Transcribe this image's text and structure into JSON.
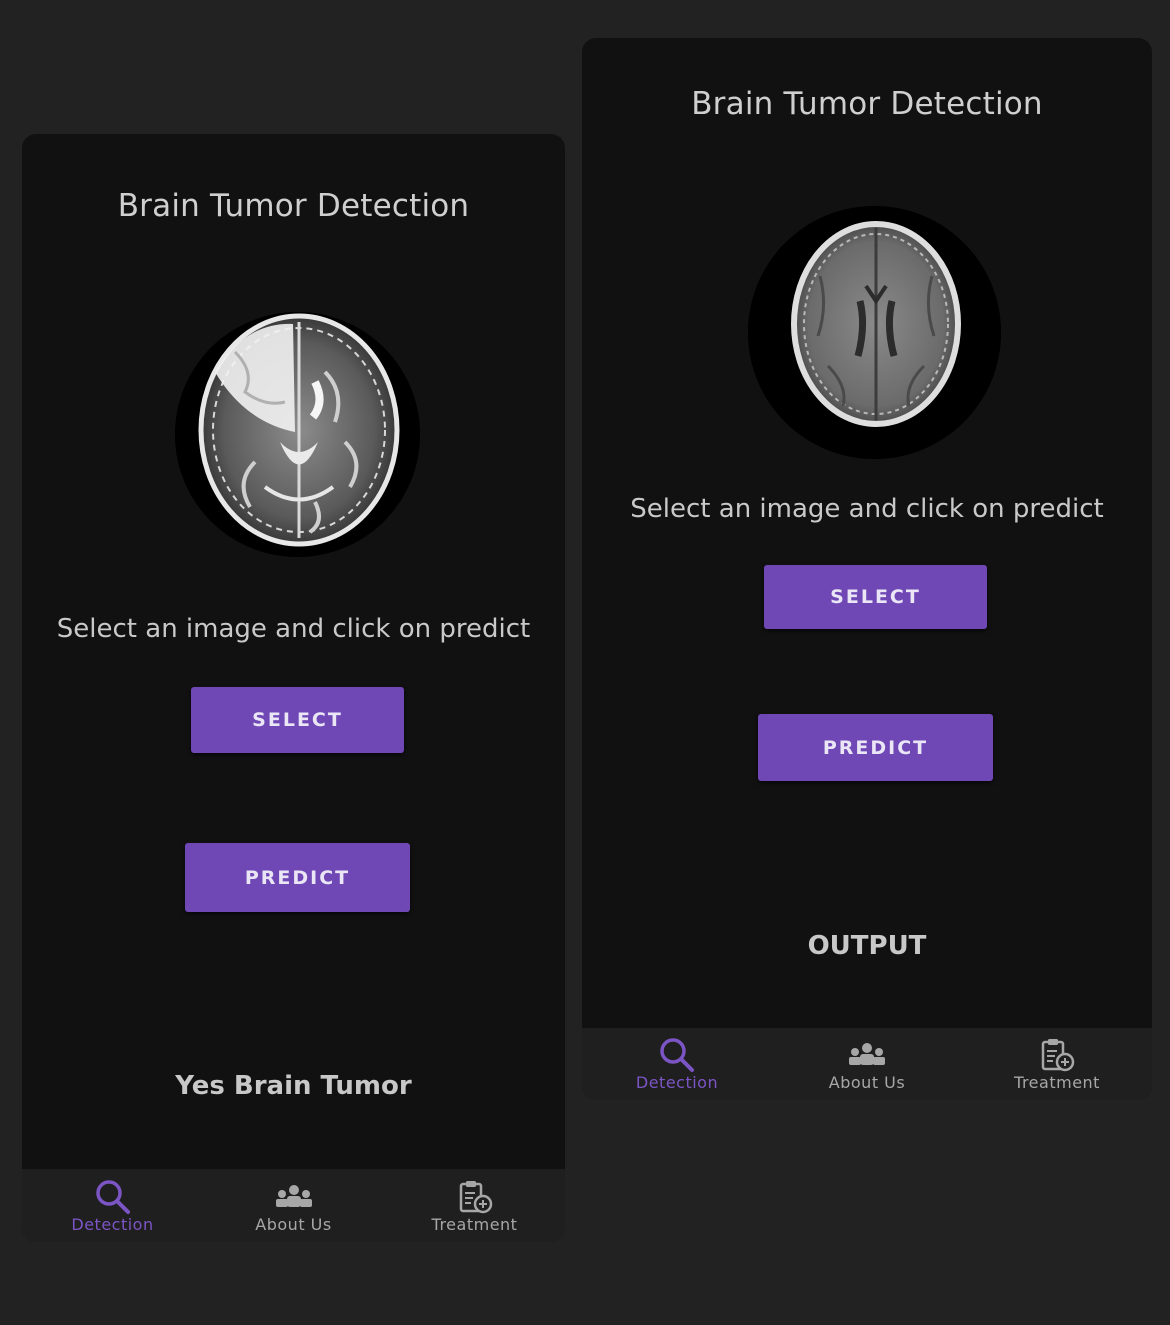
{
  "colors": {
    "accent": "#6f48b6",
    "active_nav": "#7c55c4",
    "background": "#222223",
    "screen": "#111112",
    "nav_bar": "#1f1f20"
  },
  "left_screen": {
    "title": "Brain Tumor Detection",
    "instruction": "Select an image and click on predict",
    "select_label": "SELECT",
    "predict_label": "PREDICT",
    "result": "Yes Brain Tumor",
    "nav": [
      {
        "label": "Detection",
        "icon": "search-icon",
        "active": true
      },
      {
        "label": "About Us",
        "icon": "group-icon",
        "active": false
      },
      {
        "label": "Treatment",
        "icon": "clipboard-icon",
        "active": false
      }
    ]
  },
  "right_screen": {
    "title": "Brain Tumor Detection",
    "instruction": "Select an image and click on predict",
    "select_label": "SELECT",
    "predict_label": "PREDICT",
    "result": "OUTPUT",
    "nav": [
      {
        "label": "Detection",
        "icon": "search-icon",
        "active": true
      },
      {
        "label": "About Us",
        "icon": "group-icon",
        "active": false
      },
      {
        "label": "Treatment",
        "icon": "clipboard-icon",
        "active": false
      }
    ]
  }
}
